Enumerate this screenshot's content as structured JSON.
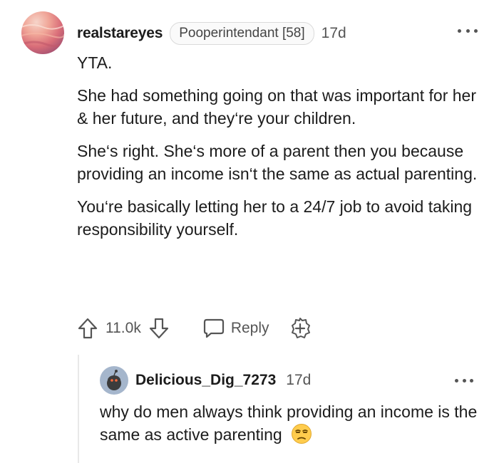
{
  "comment": {
    "author": "realstareyes",
    "flair": "Pooperintendant [58]",
    "time": "17d",
    "paragraphs": [
      "YTA.",
      "She had something going on that was important for her & her future, and they‘re your children.",
      "She‘s right. She‘s more of a parent then you because providing an income isn‘t the same as actual parenting.",
      "You‘re basically letting her to a 24/7 job to avoid taking responsibility yourself."
    ],
    "votes": "11.0k",
    "reply_label": "Reply",
    "icons": {
      "avatar": "sunset-avatar",
      "more": "more-options-icon",
      "upvote": "upvote-arrow-icon",
      "downvote": "downvote-arrow-icon",
      "reply": "speech-bubble-icon",
      "award": "award-plus-icon"
    }
  },
  "reply": {
    "author": "Delicious_Dig_7273",
    "time": "17d",
    "text": "why do men always think providing an income is the same as active parenting",
    "icons": {
      "avatar": "snoo-avatar",
      "emoji": "unamused-face-emoji",
      "more": "more-options-icon"
    }
  },
  "colors": {
    "text": "#1c1c1c",
    "muted": "#555555",
    "flair_border": "#dadada",
    "thread_line": "#e8e8e8",
    "reply_avatar_bg": "#a5b6cc",
    "emoji_yellow": "#ffcc4d"
  }
}
